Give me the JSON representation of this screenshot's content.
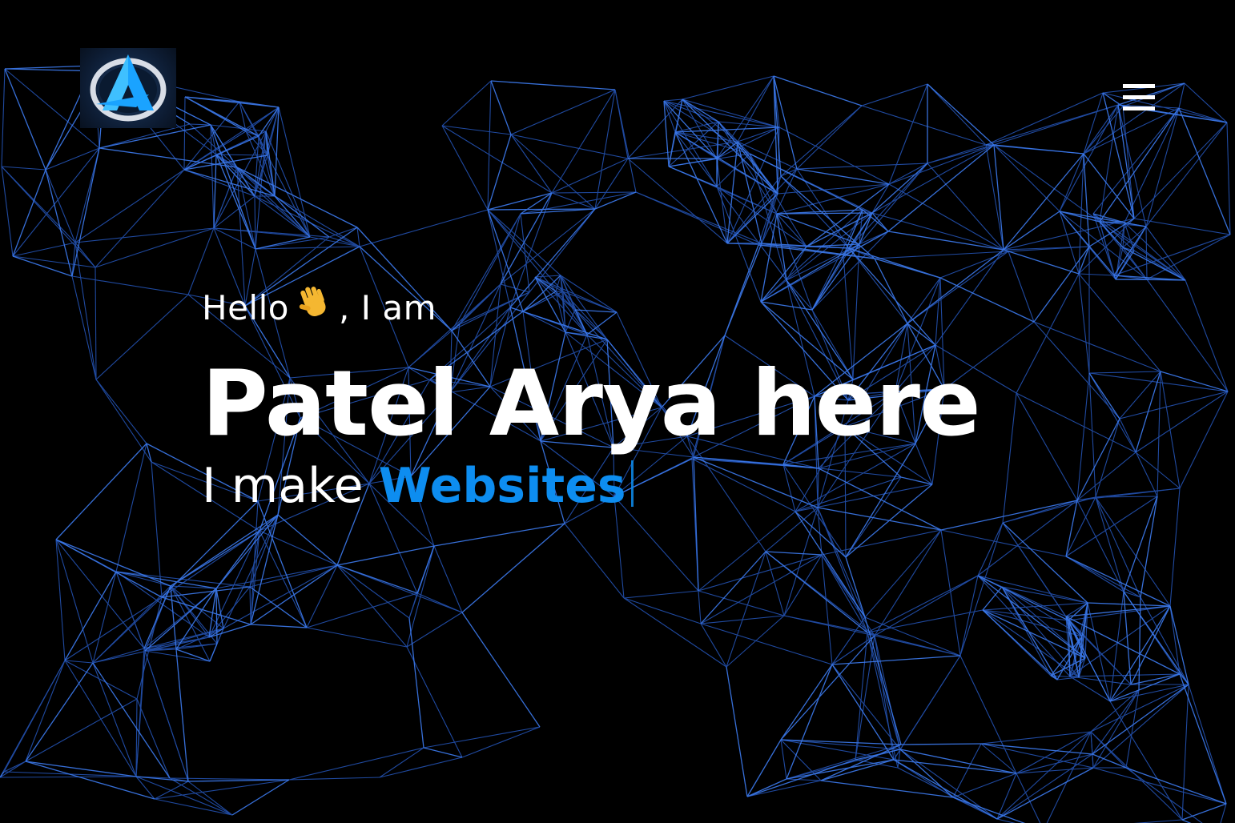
{
  "header": {
    "logo_icon": "brand-a-logo-icon",
    "menu_icon": "hamburger-menu-icon"
  },
  "hero": {
    "greeting_hello": "Hello",
    "greeting_emoji": "waving-hand-emoji",
    "greeting_suffix": ", I am",
    "name": "Patel Arya here",
    "tagline_prefix": "I make",
    "tagline_highlight": "Websites"
  },
  "colors": {
    "background": "#000000",
    "text": "#ffffff",
    "accent": "#0d8df0",
    "network_lines": "#2b63d6"
  }
}
